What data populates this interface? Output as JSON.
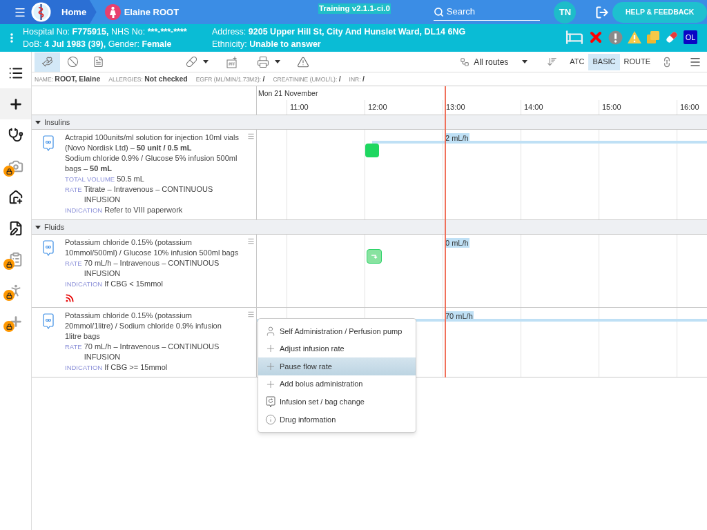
{
  "top_bar": {
    "home": "Home",
    "patient_name": "Elaine ROOT",
    "version": "Training v2.1.1-ci.0",
    "search": {
      "placeholder": "Search"
    },
    "user_initials": "TN",
    "help_button": "HELP & FEEDBACK"
  },
  "patient_banner": {
    "left": [
      [
        {
          "label": "Hospital No:",
          "value": "F775915,"
        },
        {
          "label": "NHS No:",
          "value": "***-***-****"
        }
      ],
      [
        {
          "label": "DoB:",
          "value": "4 Jul 1983 (39),"
        },
        {
          "label": "Gender:",
          "value": "Female"
        }
      ]
    ],
    "right": [
      [
        {
          "label": "Address:",
          "value": "9205 Upper Hill St, City And Hunslet Ward, DL14 6NG"
        }
      ],
      [
        {
          "label": "Ethnicity:",
          "value": "Unable to answer"
        }
      ]
    ],
    "badge": "OL"
  },
  "sidebar": {
    "items": [
      {
        "kind": "list",
        "selected": false,
        "locked": false
      },
      {
        "kind": "add",
        "selected": true,
        "locked": false
      },
      {
        "kind": "stethoscope",
        "selected": false,
        "locked": false
      },
      {
        "kind": "camera",
        "selected": false,
        "locked": true
      },
      {
        "kind": "hospital",
        "selected": false,
        "locked": false
      },
      {
        "kind": "signature",
        "selected": false,
        "locked": false
      },
      {
        "kind": "clipboard",
        "selected": false,
        "locked": true
      },
      {
        "kind": "walker",
        "selected": false,
        "locked": true
      },
      {
        "kind": "add",
        "selected": false,
        "locked": true
      }
    ]
  },
  "toolbar": {
    "views": [
      {
        "kind": "administration",
        "selected": true
      },
      {
        "kind": "discontinued",
        "selected": false
      },
      {
        "kind": "document",
        "selected": false
      }
    ],
    "route_filter": "All routes",
    "groupings": [
      {
        "label": "ATC",
        "selected": false
      },
      {
        "label": "BASIC",
        "selected": true
      },
      {
        "label": "ROUTE",
        "selected": false
      }
    ]
  },
  "info_strip": [
    {
      "label": "NAME:",
      "value": "ROOT, Elaine"
    },
    {
      "label": "ALLERGIES:",
      "value": "Not checked"
    },
    {
      "label": "EGFR (ML/MIN/1.73M2):",
      "value": "/"
    },
    {
      "label": "CREATININE (UMOL/L):",
      "value": "/"
    },
    {
      "label": "INR:",
      "value": "/"
    }
  ],
  "timeline": {
    "date": "Mon 21 November",
    "hours": [
      "11:00",
      "12:00",
      "13:00",
      "14:00",
      "15:00",
      "16:00"
    ]
  },
  "groups": [
    {
      "name": "Insulins",
      "expanded": true,
      "rows": [
        {
          "lines": [
            "Actrapid 100units/ml solution for injection 10ml vials (Novo Nordisk Ltd) – **50 unit / 0.5 mL**",
            "Sodium chloride 0.9% / Glucose 5% infusion 500ml bags – **50 mL**"
          ],
          "details": [
            {
              "label": "TOTAL VOLUME",
              "value": "50.5 mL"
            },
            {
              "label": "RATE",
              "value": "Titrate – Intravenous – CONTINUOUS INFUSION"
            },
            {
              "label": "INDICATION",
              "value": "Refer to VIII paperwork"
            }
          ],
          "alert": false,
          "rate_label": "2 mL/h",
          "marker": {
            "kind": "start"
          },
          "bar": true
        }
      ]
    },
    {
      "name": "Fluids",
      "expanded": true,
      "rows": [
        {
          "lines": [
            "Potassium chloride 0.15% (potassium 10mmol/500ml) / Glucose 10% infusion 500ml bags"
          ],
          "details": [
            {
              "label": "RATE",
              "value": "70 mL/h – Intravenous – CONTINUOUS INFUSION"
            },
            {
              "label": "INDICATION",
              "value": "If CBG < 15mmol"
            }
          ],
          "alert": true,
          "rate_label": "0 mL/h",
          "marker": {
            "kind": "restart"
          },
          "bar": false
        },
        {
          "lines": [
            "Potassium chloride 0.15% (potassium 20mmol/1litre) / Sodium chloride 0.9% infusion 1litre bags"
          ],
          "details": [
            {
              "label": "RATE",
              "value": "70 mL/h – Intravenous – CONTINUOUS INFUSION"
            },
            {
              "label": "INDICATION",
              "value": "If CBG >= 15mmol"
            }
          ],
          "alert": false,
          "rate_label": "70 mL/h",
          "bar": true
        }
      ]
    }
  ],
  "context_menu": [
    {
      "kind": "person",
      "label": "Self Administration / Perfusion pump",
      "selected": false
    },
    {
      "kind": "plus",
      "label": "Adjust infusion rate",
      "selected": false
    },
    {
      "kind": "plus",
      "label": "Pause flow rate",
      "selected": true
    },
    {
      "kind": "plus",
      "label": "Add bolus administration",
      "selected": false
    },
    {
      "kind": "bag-change",
      "label": "Infusion set / bag change",
      "selected": false
    },
    {
      "kind": "info",
      "label": "Drug information",
      "selected": false
    }
  ]
}
